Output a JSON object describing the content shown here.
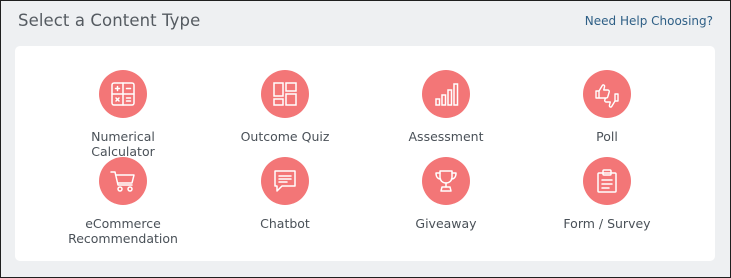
{
  "header": {
    "title": "Select a Content Type",
    "help_link": "Need Help Choosing?"
  },
  "content_types": [
    {
      "label": "Numerical Calculator",
      "icon": "calculator-icon"
    },
    {
      "label": "Outcome Quiz",
      "icon": "quiz-layout-icon"
    },
    {
      "label": "Assessment",
      "icon": "bar-chart-icon"
    },
    {
      "label": "Poll",
      "icon": "thumbs-up-down-icon"
    },
    {
      "label": "eCommerce Recommendation",
      "icon": "shopping-cart-icon"
    },
    {
      "label": "Chatbot",
      "icon": "chat-bubble-icon"
    },
    {
      "label": "Giveaway",
      "icon": "trophy-icon"
    },
    {
      "label": "Form / Survey",
      "icon": "clipboard-icon"
    }
  ],
  "colors": {
    "accent": "#f37677",
    "link": "#2e5f86",
    "background": "#eef0f2",
    "card": "#ffffff"
  }
}
